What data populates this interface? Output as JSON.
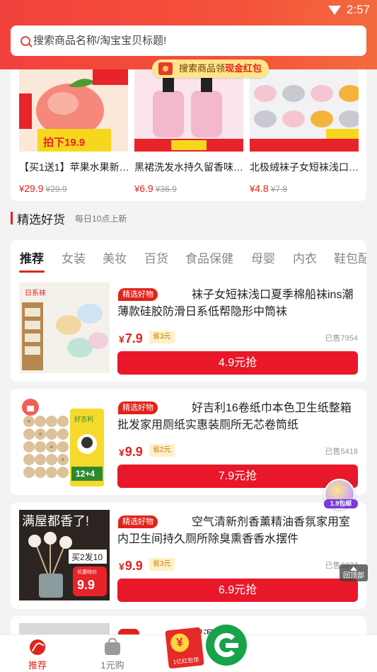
{
  "status": {
    "time": "2:57"
  },
  "search": {
    "placeholder": "搜索商品名称/淘宝宝贝标题!"
  },
  "promo_banner": {
    "prefix": "搜索商品领",
    "highlight": "现金红包"
  },
  "top_products": [
    {
      "title": "【买1送1】苹果水果新…",
      "price": "29.9",
      "original": "29.9",
      "image": "peach-fruit-image"
    },
    {
      "title": "黑裙洗发水持久留香味…",
      "price": "6.9",
      "original": "36.9",
      "image": "shampoo-bottles-image"
    },
    {
      "title": "北极绒袜子女短袜浅口…",
      "price": "4.8",
      "original": "7.8",
      "image": "socks-image"
    }
  ],
  "section": {
    "title": "精选好货",
    "subtitle": "每日10点上新"
  },
  "tabs": [
    "推荐",
    "女装",
    "美妆",
    "百货",
    "食品保健",
    "母婴",
    "内衣",
    "鞋包配"
  ],
  "items": [
    {
      "tag": "精选好物",
      "name": "袜子女短袜浅口夏季棉船袜ins潮薄款硅胶防滑日系低帮隐形中筒袜",
      "price": "7.9",
      "coupon": "省3元",
      "sold": "已售7954",
      "button": "4.9元抢"
    },
    {
      "tag": "精选好物",
      "name": "好吉利16卷纸巾本色卫生纸整箱批发家用厕纸实惠装厕所无芯卷筒纸",
      "price": "9.9",
      "coupon": "省2元",
      "sold": "已售5418",
      "button": "7.9元抢"
    },
    {
      "tag": "精选好物",
      "name": "空气清新剂香薰精油香氛家用室内卫生间持久厕所除臭熏香香水摆件",
      "price": "9.9",
      "coupon": "省3元",
      "sold": "已售3377",
      "button": "6.9元抢"
    },
    {
      "tag": "",
      "name": "保温杯",
      "price": "",
      "coupon": "",
      "sold": "",
      "button": ""
    }
  ],
  "item_images": {
    "socks_promo_text": "日系袜",
    "tissue_brand": "好吉利",
    "tissue_count": "12+4",
    "fragrance_headline": "满屋都香了!",
    "fragrance_offer": "买2发10",
    "fragrance_price_label": "优惠特价",
    "fragrance_price": "9.9"
  },
  "floating": {
    "badge": "1.9包邮",
    "to_top": "回顶部"
  },
  "bottom_nav": [
    {
      "label": "推荐",
      "icon": "feather-icon",
      "active": true
    },
    {
      "label": "1元购",
      "icon": "bag-icon",
      "active": false
    }
  ],
  "center_promo": {
    "label": "1亿红包领"
  },
  "colors": {
    "accent": "#e2231a",
    "header_start": "#f2413d",
    "header_end": "#f36a3f",
    "button": "#e8182a"
  }
}
